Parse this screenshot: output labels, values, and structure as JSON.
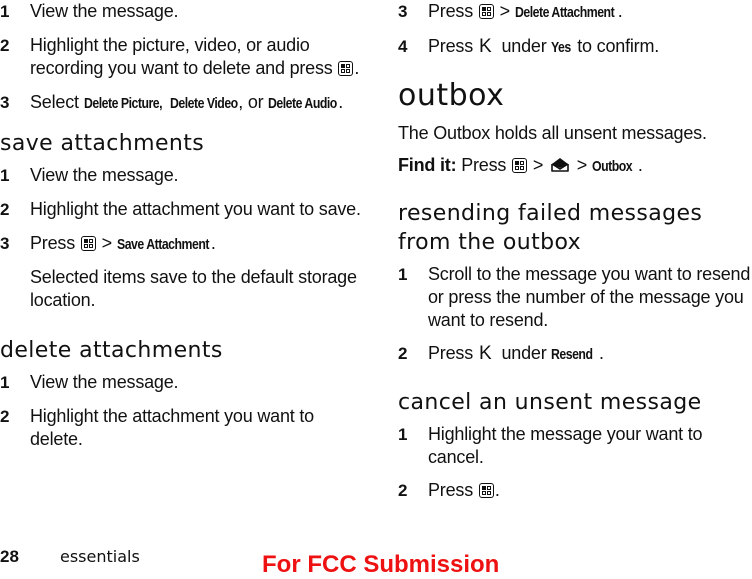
{
  "left_column": {
    "intro_steps": [
      {
        "num": "1",
        "text": "View the message."
      },
      {
        "num": "2",
        "text_before": "Highlight the picture, video, or audio recording you want to delete and press",
        "icon": "menu-key-icon",
        "text_after": "."
      },
      {
        "num": "3",
        "text_before": "Select",
        "kw1": "Delete Picture,",
        "kw2": "Delete Video",
        "mid": ", or",
        "kw3": "Delete Audio",
        "text_after": "."
      }
    ],
    "save_attachments": {
      "heading": "save attachments",
      "steps": [
        {
          "num": "1",
          "text": "View the message."
        },
        {
          "num": "2",
          "text": "Highlight the attachment you want to save."
        },
        {
          "num": "3",
          "text_before": "Press",
          "icon": "menu-key-icon",
          "separator": ">",
          "kw": "Save Attachment",
          "text_after": "."
        }
      ],
      "note": "Selected items save to the default storage location."
    },
    "delete_attachments": {
      "heading": "delete attachments",
      "steps": [
        {
          "num": "1",
          "text": "View the message."
        },
        {
          "num": "2",
          "text": "Highlight the attachment you want to delete."
        }
      ]
    }
  },
  "right_column": {
    "continued_steps": [
      {
        "num": "3",
        "text_before": "Press",
        "icon": "menu-key-icon",
        "separator": ">",
        "kw": "Delete Attachment",
        "text_after": "."
      },
      {
        "num": "4",
        "text_before": "Press",
        "softkey": "K",
        "mid": "under",
        "kw": "Yes",
        "text_after": "to confirm."
      }
    ],
    "outbox": {
      "heading": "outbox",
      "description": "The Outbox holds all unsent messages.",
      "find_it_label": "Find it:",
      "find_it_press": "Press",
      "separator": ">",
      "find_it_kw": "Outbox",
      "find_it_end": "."
    },
    "resending": {
      "heading_line1": "resending failed messages",
      "heading_line2": "from the outbox",
      "steps": [
        {
          "num": "1",
          "text": "Scroll to the message you want to resend or press the number of the message you want to resend."
        },
        {
          "num": "2",
          "text_before": "Press",
          "softkey": "K",
          "mid": "under",
          "kw": "Resend",
          "text_after": "."
        }
      ]
    },
    "cancel": {
      "heading": "cancel an unsent message",
      "steps": [
        {
          "num": "1",
          "text": "Highlight the message your want to cancel."
        },
        {
          "num": "2",
          "text_before": "Press",
          "icon": "menu-key-icon",
          "text_after": "."
        }
      ]
    }
  },
  "footer": {
    "page_number": "28",
    "section": "essentials",
    "watermark": "For FCC Submission",
    "watermark_color": "#ee1111"
  }
}
